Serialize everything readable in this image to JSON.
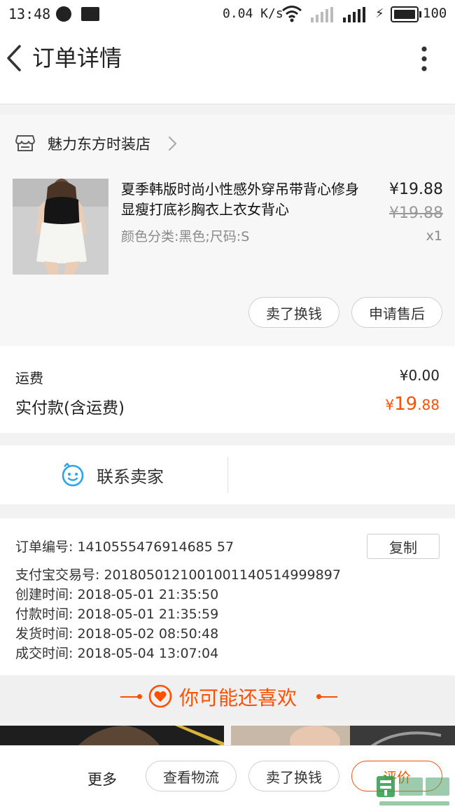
{
  "status_bar": {
    "time": "13:48",
    "net_speed": "0.04 K/s",
    "battery": "100"
  },
  "header": {
    "title": "订单详情"
  },
  "shop": {
    "name": "魅力东方时装店"
  },
  "product": {
    "title": "夏季韩版时尚小性感外穿吊带背心修身显瘦打底衫胸衣上衣女背心",
    "attributes": "颜色分类:黑色;尺码:S",
    "price": "¥19.88",
    "original_price": "¥19.88",
    "quantity": "x1",
    "actions": {
      "sell": "卖了换钱",
      "after_sale": "申请售后"
    }
  },
  "fees": {
    "shipping_label": "运费",
    "shipping_value": "¥0.00",
    "paid_label": "实付款(含运费)",
    "paid_currency": "¥",
    "paid_integer": "19",
    "paid_decimal": ".88"
  },
  "contact": {
    "label": "联系卖家"
  },
  "order_info": {
    "order_no": "订单编号:  1410555476914685 57",
    "copy_label": "复制",
    "lines": [
      "支付宝交易号:  2018050121001001140514999897",
      "创建时间:  2018-05-01 21:35:50",
      "付款时间:  2018-05-01 21:35:59",
      "发货时间:  2018-05-02 08:50:48",
      "成交时间:  2018-05-04 13:07:04"
    ]
  },
  "recommend": {
    "title": "你可能还喜欢"
  },
  "bottom_bar": {
    "more": "更多",
    "logistics": "查看物流",
    "sell": "卖了换钱",
    "review": "评价"
  },
  "colors": {
    "accent": "#ff5000",
    "contact_icon": "#2aa5e8"
  }
}
